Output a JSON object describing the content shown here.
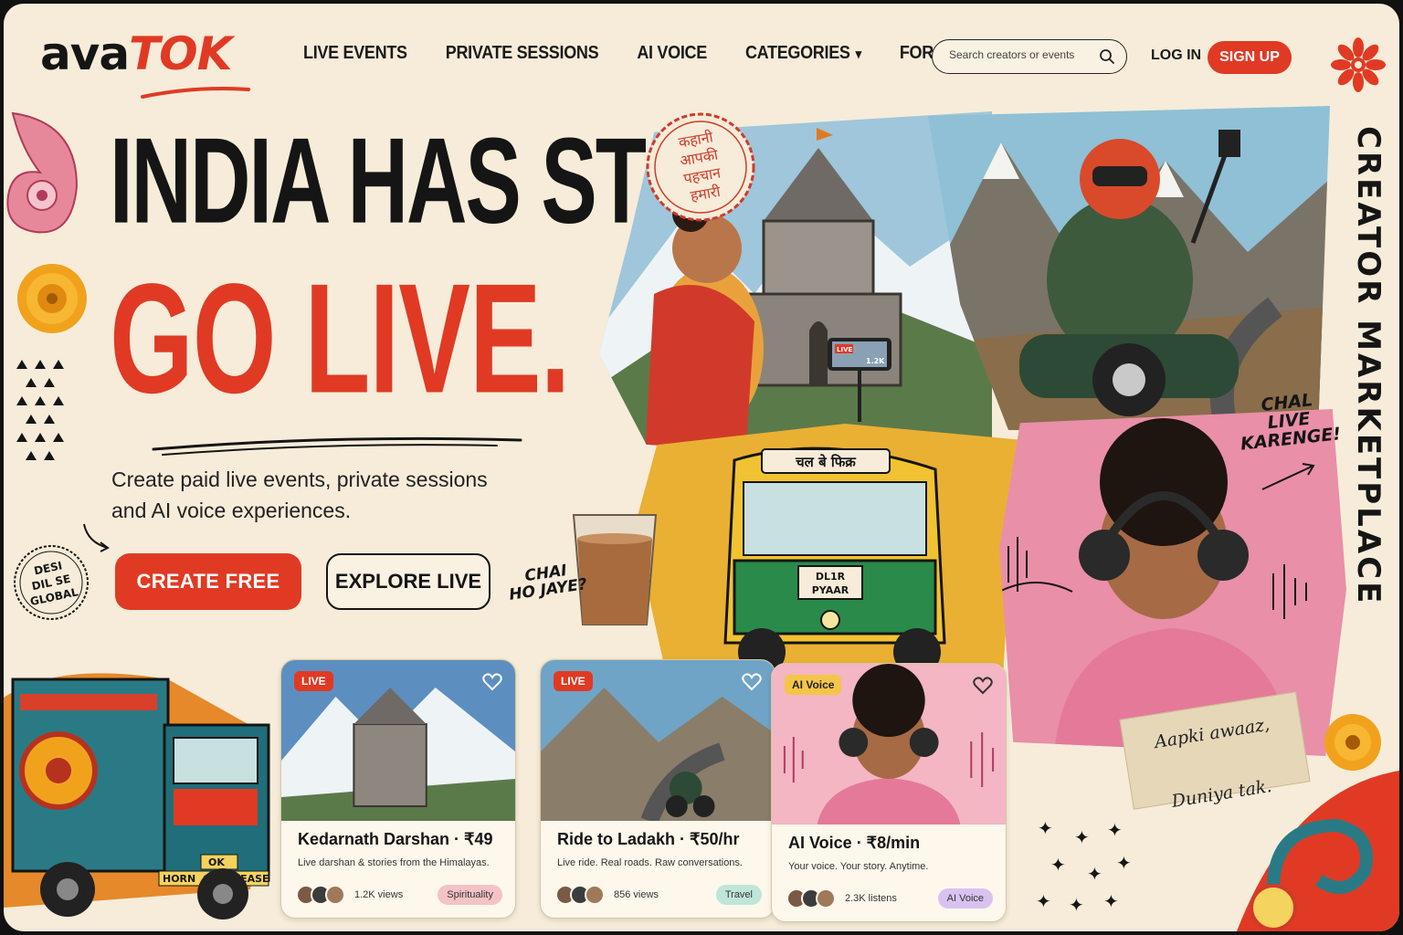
{
  "brand": {
    "logo_part1": "ava",
    "logo_part2": "TOK"
  },
  "nav": {
    "items": [
      "LIVE EVENTS",
      "PRIVATE SESSIONS",
      "AI VOICE",
      "CATEGORIES",
      "FOR CREATORS"
    ],
    "categories_chevron": "chevron-down-icon"
  },
  "search": {
    "placeholder": "Search creators or events"
  },
  "auth": {
    "login": "LOG IN",
    "signup": "SIGN UP"
  },
  "hero": {
    "headline_1": "INDIA HAS STORIES.",
    "headline_2": "GO LIVE.",
    "subtitle": "Create paid live events, private sessions and AI voice experiences.",
    "cta_primary": "CREATE FREE",
    "cta_secondary": "EXPLORE LIVE"
  },
  "stamps": {
    "desi": [
      "DESI",
      "DIL SE",
      "GLOBAL"
    ],
    "hindi": [
      "कहानी",
      "आपकी",
      "पहचान",
      "हमारी"
    ]
  },
  "side_text": "CREATOR MARKETPLACE",
  "collage": {
    "live_badge": "LIVE",
    "live_count": "1.2K",
    "auto_sign": "चल बे फिक्र",
    "auto_plate": [
      "DL1R",
      "PYAAR"
    ],
    "truck_plate": [
      "OK",
      "HORN",
      "OK",
      "PLEASE"
    ],
    "callout_chal": [
      "CHAL",
      "LIVE",
      "KARENGE!"
    ],
    "callout_chai": [
      "CHAI",
      "HO JAYE?"
    ],
    "tape_note": [
      "Aapki awaaz,",
      "Duniya tak."
    ]
  },
  "cards": [
    {
      "badge": "LIVE",
      "title": "Kedarnath Darshan  ·  ₹49",
      "desc": "Live darshan & stories from the Himalayas.",
      "views": "1.2K views",
      "tag": "Spirituality",
      "tag_color": "#f5c2c6"
    },
    {
      "badge": "LIVE",
      "title": "Ride to Ladakh  ·  ₹50/hr",
      "desc": "Live ride. Real roads. Raw conversations.",
      "views": "856 views",
      "tag": "Travel",
      "tag_color": "#bfe6d8"
    },
    {
      "badge": "AI Voice",
      "title": "AI Voice  ·  ₹8/min",
      "desc": "Your voice. Your story. Anytime.",
      "views": "2.3K listens",
      "tag": "AI Voice",
      "tag_color": "#d8c3f0"
    }
  ],
  "colors": {
    "accent": "#e03a24",
    "background": "#f6ecd9",
    "ink": "#151515"
  }
}
